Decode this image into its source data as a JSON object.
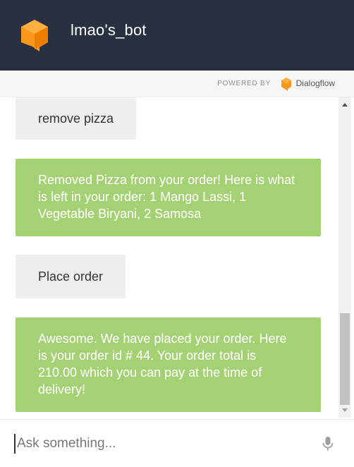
{
  "header": {
    "bot_name": "lmao's_bot"
  },
  "powered_by": {
    "label": "POWERED BY",
    "brand": "Dialogflow"
  },
  "messages": [
    {
      "role": "user",
      "text": "remove pizza"
    },
    {
      "role": "bot",
      "text": "Removed Pizza from your order! Here is what is left in your order: 1 Mango Lassi, 1 Vegetable Biryani, 2 Samosa"
    },
    {
      "role": "user",
      "text": "Place order"
    },
    {
      "role": "bot",
      "text": "Awesome. We have placed your order. Here is your order id # 44. Your order total is 210.00 which you can pay at the time of delivery!"
    }
  ],
  "input": {
    "placeholder": "Ask something..."
  },
  "icons": {
    "logo": "dialogflow-cube-icon",
    "mic": "microphone-icon"
  },
  "colors": {
    "header_bg": "#283041",
    "bot_bubble": "#a5d175",
    "user_bubble": "#eeeeee",
    "brand_orange": "#f8981d"
  }
}
